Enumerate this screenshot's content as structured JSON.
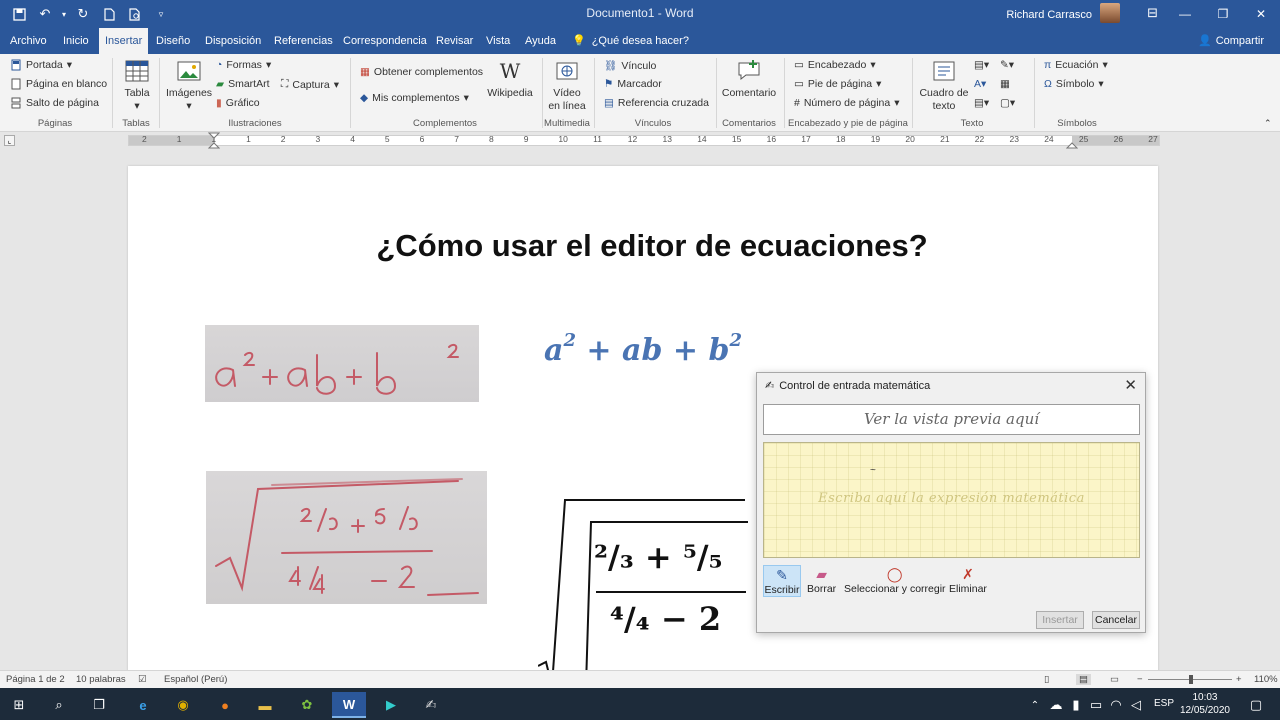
{
  "titlebar": {
    "document_title": "Documento1  -  Word",
    "user_name": "Richard Carrasco"
  },
  "tabs": [
    "Archivo",
    "Inicio",
    "Insertar",
    "Diseño",
    "Disposición",
    "Referencias",
    "Correspondencia",
    "Revisar",
    "Vista",
    "Ayuda"
  ],
  "active_tab": "Insertar",
  "tell_me": "¿Qué desea hacer?",
  "share_label": "Compartir",
  "ribbon": {
    "paginas": {
      "label": "Páginas",
      "items": [
        "Portada",
        "Página en blanco",
        "Salto de página"
      ]
    },
    "tablas": {
      "label": "Tablas",
      "button": "Tabla"
    },
    "ilustraciones": {
      "label": "Ilustraciones",
      "imagenes": "Imágenes",
      "formas": "Formas",
      "smartart": "SmartArt",
      "grafico": "Gráfico",
      "captura": "Captura"
    },
    "complementos": {
      "label": "Complementos",
      "obtener": "Obtener complementos",
      "mis": "Mis complementos",
      "wikipedia": "Wikipedia"
    },
    "multimedia": {
      "label": "Multimedia",
      "video_line1": "Vídeo",
      "video_line2": "en línea"
    },
    "vinculos": {
      "label": "Vínculos",
      "items": [
        "Vínculo",
        "Marcador",
        "Referencia cruzada"
      ]
    },
    "comentarios": {
      "label": "Comentarios",
      "button": "Comentario"
    },
    "encabezado": {
      "label": "Encabezado y pie de página",
      "items": [
        "Encabezado",
        "Pie de página",
        "Número de página"
      ]
    },
    "texto": {
      "label": "Texto",
      "cuadro_line1": "Cuadro de",
      "cuadro_line2": "texto"
    },
    "simbolos": {
      "label": "Símbolos",
      "ecuacion": "Ecuación",
      "simbolo": "Símbolo"
    }
  },
  "ruler_numbers": [
    "2",
    "1",
    "1",
    "1",
    "2",
    "3",
    "4",
    "5",
    "6",
    "7",
    "8",
    "9",
    "10",
    "11",
    "12",
    "13",
    "14",
    "15",
    "16",
    "17",
    "18",
    "19",
    "20",
    "21",
    "22",
    "23",
    "24",
    "25",
    "26",
    "27"
  ],
  "document": {
    "heading": "¿Cómo usar el editor de ecuaciones?",
    "eq1": {
      "a": "a",
      "a_exp": "2",
      "mid": " + ab + b",
      "b_exp": "2"
    },
    "frac_top": "²/₃ + ⁵/₅",
    "frac_bottom": "⁴/₄ − 2"
  },
  "math_dialog": {
    "title": "Control de entrada matemática",
    "preview_placeholder": "Ver la vista previa aquí",
    "writepad_hint": "Escriba aquí la expresión matemática",
    "tools": [
      "Escribir",
      "Borrar",
      "Seleccionar y corregir",
      "Eliminar"
    ],
    "insert_label": "Insertar",
    "cancel_label": "Cancelar"
  },
  "status": {
    "page": "Página 1 de 2",
    "words": "10 palabras",
    "language": "Español (Perú)",
    "zoom": "110%"
  },
  "taskbar": {
    "lang": "ESP",
    "time": "10:03",
    "date": "12/05/2020"
  },
  "colors": {
    "word_blue": "#2b579a",
    "equation_blue": "#4a74b3",
    "writepad_yellow": "#fbf5c8"
  }
}
